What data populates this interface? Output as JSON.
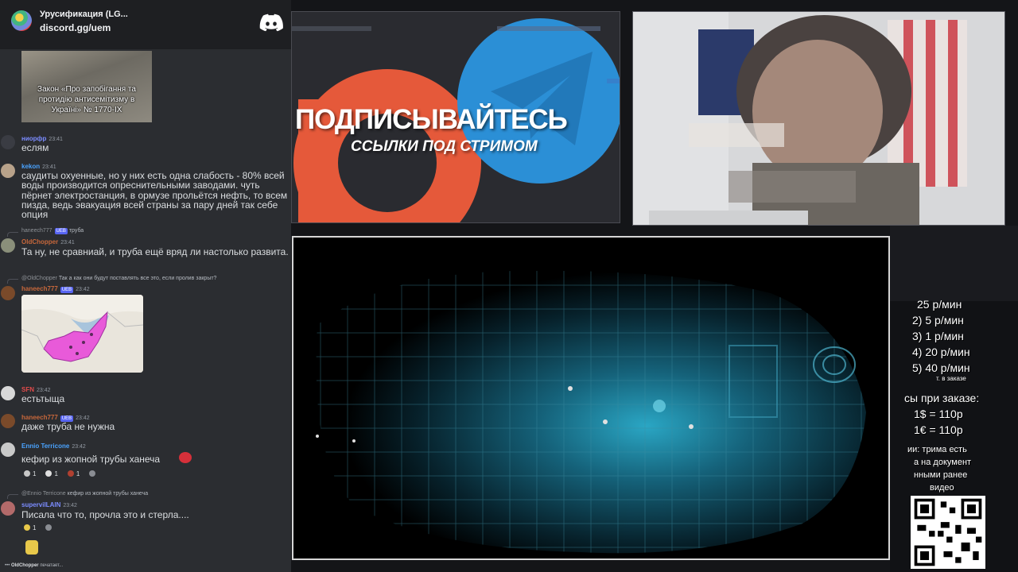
{
  "header": {
    "server_name": "Урусификация (LG...",
    "invite": "discord.gg/uem"
  },
  "embed_law": {
    "caption": "Закон «Про запобігання та протидію антисемітизму в Україні» № 1770-IX"
  },
  "messages": [
    {
      "user": "ниорфр",
      "user_color": "#7b8cff",
      "time": "23:41",
      "text": "еслям"
    },
    {
      "user": "kekon",
      "user_color": "#4aa3ff",
      "time": "23:41",
      "text": "саудиты охуенные, но у них есть одна слабость - 80% всей воды производится опреснительными заводами. чуть пёрнет электростанция, в ормузе прольётся нефть, то всем пизда, ведь эвакуация всей страны за пару дней так себе опция"
    },
    {
      "reply_user": "haneech777",
      "reply_badge": "UEB",
      "reply_text": "труба",
      "user": "OldChopper",
      "user_color": "#c6673b",
      "time": "23:41",
      "text": "Та ну, не сравниай, и труба ещё вряд ли настолько развита."
    },
    {
      "reply_user": "@OldChopper",
      "reply_text": "Так а как они будут поставлять все это, если пролив закрыт?",
      "user": "haneech777",
      "user_color": "#c6673b",
      "badge": "UEB",
      "time": "23:42"
    },
    {
      "user": "SFN",
      "user_color": "#e24b4b",
      "time": "23:42",
      "text": "естьтыща"
    },
    {
      "user": "haneech777",
      "user_color": "#c6673b",
      "badge": "UEB",
      "time": "23:42",
      "text": "даже труба не нужна"
    },
    {
      "user": "Ennio Terricone",
      "user_color": "#4aa3ff",
      "time": "23:42",
      "text": "кефир из жопной трубы ханеча",
      "reactions": [
        "1",
        "1",
        "1"
      ]
    },
    {
      "reply_user": "@Ennio Terricone",
      "reply_text": "кефир из жопной трубы ханеча",
      "user": "supervilLAIN",
      "user_color": "#7b8cff",
      "time": "23:42",
      "text": "Писала что то, прочла это и стерла....",
      "reactions": [
        "1"
      ]
    }
  ],
  "typing": {
    "user": "OldChopper",
    "text": "печатает..."
  },
  "banner": {
    "title": "ПОДПИСЫВАЙТЕСЬ",
    "subtitle": "ССЫЛКИ ПОД СТРИМОМ",
    "patreon_color": "#e5593a",
    "telegram_color": "#2b8fd6"
  },
  "info": {
    "lines": [
      "25  р/мин",
      "2) 5  р/мин",
      "3) 1   р/мин",
      "4) 20   р/мин",
      "5) 40 р/мин",
      "т. в заказе",
      "сы при заказе:",
      "1$ = 110р",
      "1€ = 110р",
      "ии: трима есть",
      "а на документ",
      "нными ранее",
      "видео"
    ]
  }
}
